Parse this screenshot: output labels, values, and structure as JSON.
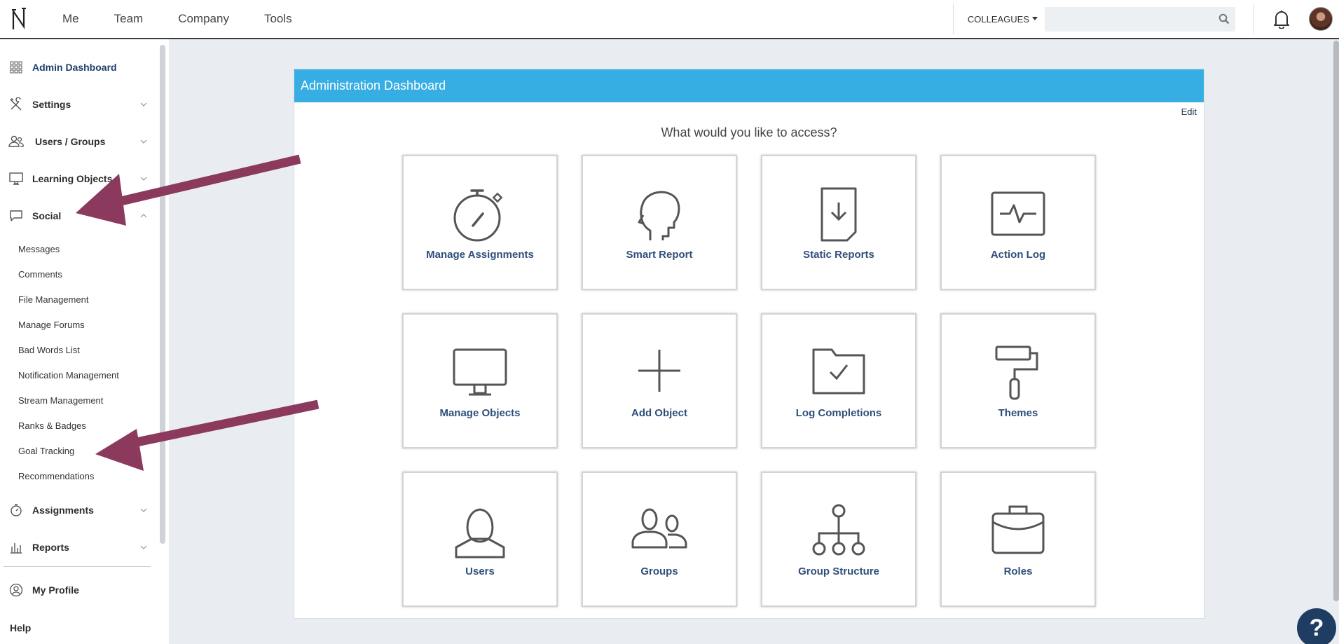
{
  "topnav": {
    "items": [
      "Me",
      "Team",
      "Company",
      "Tools"
    ],
    "colleagues_label": "COLLEAGUES",
    "search_value": ""
  },
  "sidebar": {
    "admin_dashboard": "Admin Dashboard",
    "settings": "Settings",
    "users_groups": "Users / Groups",
    "learning_objects": "Learning Objects",
    "social": "Social",
    "social_items": [
      "Messages",
      "Comments",
      "File Management",
      "Manage Forums",
      "Bad Words List",
      "Notification Management",
      "Stream Management",
      "Ranks & Badges",
      "Goal Tracking",
      "Recommendations"
    ],
    "assignments": "Assignments",
    "reports": "Reports",
    "my_profile": "My Profile",
    "help": "Help"
  },
  "panel": {
    "title": "Administration Dashboard",
    "edit_label": "Edit",
    "question": "What would you like to access?",
    "tiles": [
      {
        "label": "Manage Assignments",
        "icon": "stopwatch-icon"
      },
      {
        "label": "Smart Report",
        "icon": "head-profile-icon"
      },
      {
        "label": "Static Reports",
        "icon": "document-download-icon"
      },
      {
        "label": "Action Log",
        "icon": "pulse-monitor-icon"
      },
      {
        "label": "Manage Objects",
        "icon": "monitor-icon"
      },
      {
        "label": "Add Object",
        "icon": "plus-icon"
      },
      {
        "label": "Log Completions",
        "icon": "folder-check-icon"
      },
      {
        "label": "Themes",
        "icon": "paint-roller-icon"
      },
      {
        "label": "Users",
        "icon": "user-icon"
      },
      {
        "label": "Groups",
        "icon": "group-icon"
      },
      {
        "label": "Group Structure",
        "icon": "hierarchy-icon"
      },
      {
        "label": "Roles",
        "icon": "briefcase-icon"
      }
    ]
  },
  "help_button": "?",
  "colors": {
    "header_blue": "#36aee3",
    "tile_label": "#2f4f7a",
    "annotation_arrow": "#8b3a5e",
    "help_bg": "#1f3d63"
  }
}
